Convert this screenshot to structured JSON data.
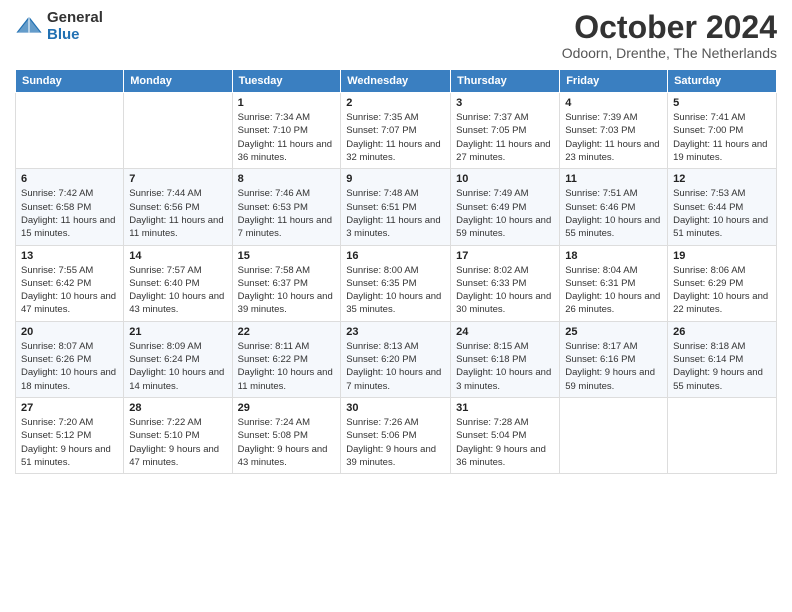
{
  "logo": {
    "general": "General",
    "blue": "Blue"
  },
  "title": "October 2024",
  "subtitle": "Odoorn, Drenthe, The Netherlands",
  "days_of_week": [
    "Sunday",
    "Monday",
    "Tuesday",
    "Wednesday",
    "Thursday",
    "Friday",
    "Saturday"
  ],
  "weeks": [
    [
      {
        "day": "",
        "info": ""
      },
      {
        "day": "",
        "info": ""
      },
      {
        "day": "1",
        "info": "Sunrise: 7:34 AM\nSunset: 7:10 PM\nDaylight: 11 hours and 36 minutes."
      },
      {
        "day": "2",
        "info": "Sunrise: 7:35 AM\nSunset: 7:07 PM\nDaylight: 11 hours and 32 minutes."
      },
      {
        "day": "3",
        "info": "Sunrise: 7:37 AM\nSunset: 7:05 PM\nDaylight: 11 hours and 27 minutes."
      },
      {
        "day": "4",
        "info": "Sunrise: 7:39 AM\nSunset: 7:03 PM\nDaylight: 11 hours and 23 minutes."
      },
      {
        "day": "5",
        "info": "Sunrise: 7:41 AM\nSunset: 7:00 PM\nDaylight: 11 hours and 19 minutes."
      }
    ],
    [
      {
        "day": "6",
        "info": "Sunrise: 7:42 AM\nSunset: 6:58 PM\nDaylight: 11 hours and 15 minutes."
      },
      {
        "day": "7",
        "info": "Sunrise: 7:44 AM\nSunset: 6:56 PM\nDaylight: 11 hours and 11 minutes."
      },
      {
        "day": "8",
        "info": "Sunrise: 7:46 AM\nSunset: 6:53 PM\nDaylight: 11 hours and 7 minutes."
      },
      {
        "day": "9",
        "info": "Sunrise: 7:48 AM\nSunset: 6:51 PM\nDaylight: 11 hours and 3 minutes."
      },
      {
        "day": "10",
        "info": "Sunrise: 7:49 AM\nSunset: 6:49 PM\nDaylight: 10 hours and 59 minutes."
      },
      {
        "day": "11",
        "info": "Sunrise: 7:51 AM\nSunset: 6:46 PM\nDaylight: 10 hours and 55 minutes."
      },
      {
        "day": "12",
        "info": "Sunrise: 7:53 AM\nSunset: 6:44 PM\nDaylight: 10 hours and 51 minutes."
      }
    ],
    [
      {
        "day": "13",
        "info": "Sunrise: 7:55 AM\nSunset: 6:42 PM\nDaylight: 10 hours and 47 minutes."
      },
      {
        "day": "14",
        "info": "Sunrise: 7:57 AM\nSunset: 6:40 PM\nDaylight: 10 hours and 43 minutes."
      },
      {
        "day": "15",
        "info": "Sunrise: 7:58 AM\nSunset: 6:37 PM\nDaylight: 10 hours and 39 minutes."
      },
      {
        "day": "16",
        "info": "Sunrise: 8:00 AM\nSunset: 6:35 PM\nDaylight: 10 hours and 35 minutes."
      },
      {
        "day": "17",
        "info": "Sunrise: 8:02 AM\nSunset: 6:33 PM\nDaylight: 10 hours and 30 minutes."
      },
      {
        "day": "18",
        "info": "Sunrise: 8:04 AM\nSunset: 6:31 PM\nDaylight: 10 hours and 26 minutes."
      },
      {
        "day": "19",
        "info": "Sunrise: 8:06 AM\nSunset: 6:29 PM\nDaylight: 10 hours and 22 minutes."
      }
    ],
    [
      {
        "day": "20",
        "info": "Sunrise: 8:07 AM\nSunset: 6:26 PM\nDaylight: 10 hours and 18 minutes."
      },
      {
        "day": "21",
        "info": "Sunrise: 8:09 AM\nSunset: 6:24 PM\nDaylight: 10 hours and 14 minutes."
      },
      {
        "day": "22",
        "info": "Sunrise: 8:11 AM\nSunset: 6:22 PM\nDaylight: 10 hours and 11 minutes."
      },
      {
        "day": "23",
        "info": "Sunrise: 8:13 AM\nSunset: 6:20 PM\nDaylight: 10 hours and 7 minutes."
      },
      {
        "day": "24",
        "info": "Sunrise: 8:15 AM\nSunset: 6:18 PM\nDaylight: 10 hours and 3 minutes."
      },
      {
        "day": "25",
        "info": "Sunrise: 8:17 AM\nSunset: 6:16 PM\nDaylight: 9 hours and 59 minutes."
      },
      {
        "day": "26",
        "info": "Sunrise: 8:18 AM\nSunset: 6:14 PM\nDaylight: 9 hours and 55 minutes."
      }
    ],
    [
      {
        "day": "27",
        "info": "Sunrise: 7:20 AM\nSunset: 5:12 PM\nDaylight: 9 hours and 51 minutes."
      },
      {
        "day": "28",
        "info": "Sunrise: 7:22 AM\nSunset: 5:10 PM\nDaylight: 9 hours and 47 minutes."
      },
      {
        "day": "29",
        "info": "Sunrise: 7:24 AM\nSunset: 5:08 PM\nDaylight: 9 hours and 43 minutes."
      },
      {
        "day": "30",
        "info": "Sunrise: 7:26 AM\nSunset: 5:06 PM\nDaylight: 9 hours and 39 minutes."
      },
      {
        "day": "31",
        "info": "Sunrise: 7:28 AM\nSunset: 5:04 PM\nDaylight: 9 hours and 36 minutes."
      },
      {
        "day": "",
        "info": ""
      },
      {
        "day": "",
        "info": ""
      }
    ]
  ]
}
